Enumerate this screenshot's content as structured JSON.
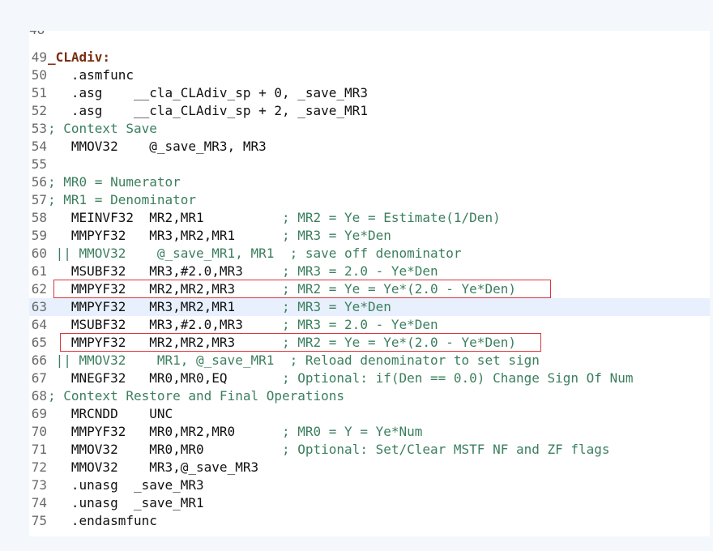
{
  "colors": {
    "comment": "#3b7f5e",
    "label": "#7a2e10",
    "highlight_border": "#d9363e",
    "current_line": "#e8f0fe"
  },
  "lines": [
    {
      "num": "49",
      "text": "",
      "label": "_CLAdiv:",
      "comment": ""
    },
    {
      "num": "50",
      "text": "   .asmfunc",
      "label": "",
      "comment": ""
    },
    {
      "num": "51",
      "text": "   .asg    __cla_CLAdiv_sp + 0, _save_MR3",
      "label": "",
      "comment": ""
    },
    {
      "num": "52",
      "text": "   .asg    __cla_CLAdiv_sp + 2, _save_MR1",
      "label": "",
      "comment": ""
    },
    {
      "num": "53",
      "text": "",
      "label": "",
      "comment": "; Context Save"
    },
    {
      "num": "54",
      "text": "   MMOV32    @_save_MR3, MR3",
      "label": "",
      "comment": ""
    },
    {
      "num": "55",
      "text": "",
      "label": "",
      "comment": ""
    },
    {
      "num": "56",
      "text": "",
      "label": "",
      "comment": "; MR0 = Numerator"
    },
    {
      "num": "57",
      "text": "",
      "label": "",
      "comment": "; MR1 = Denominator"
    },
    {
      "num": "58",
      "text": "   MEINVF32  MR2,MR1          ",
      "label": "",
      "comment": "; MR2 = Ye = Estimate(1/Den)"
    },
    {
      "num": "59",
      "text": "   MMPYF32   MR3,MR2,MR1      ",
      "label": "",
      "comment": "; MR3 = Ye*Den"
    },
    {
      "num": "60",
      "text": "",
      "label": "",
      "comment": " || MMOV32    @_save_MR1, MR1  ; save off denominator"
    },
    {
      "num": "61",
      "text": "   MSUBF32   MR3,#2.0,MR3     ",
      "label": "",
      "comment": "; MR3 = 2.0 - Ye*Den"
    },
    {
      "num": "62",
      "text": "   MMPYF32   MR2,MR2,MR3      ",
      "label": "",
      "comment": "; MR2 = Ye = Ye*(2.0 - Ye*Den)"
    },
    {
      "num": "63",
      "text": "   MMPYF32   MR3,MR2,MR1      ",
      "label": "",
      "comment": "; MR3 = Ye*Den"
    },
    {
      "num": "64",
      "text": "   MSUBF32   MR3,#2.0,MR3     ",
      "label": "",
      "comment": "; MR3 = 2.0 - Ye*Den"
    },
    {
      "num": "65",
      "text": "   MMPYF32   MR2,MR2,MR3      ",
      "label": "",
      "comment": "; MR2 = Ye = Ye*(2.0 - Ye*Den)"
    },
    {
      "num": "66",
      "text": "",
      "label": "",
      "comment": " || MMOV32    MR1, @_save_MR1  ; Reload denominator to set sign"
    },
    {
      "num": "67",
      "text": "   MNEGF32   MR0,MR0,EQ       ",
      "label": "",
      "comment": "; Optional: if(Den == 0.0) Change Sign Of Num"
    },
    {
      "num": "68",
      "text": "",
      "label": "",
      "comment": "; Context Restore and Final Operations"
    },
    {
      "num": "69",
      "text": "   MRCNDD    UNC",
      "label": "",
      "comment": ""
    },
    {
      "num": "70",
      "text": "   MMPYF32   MR0,MR2,MR0      ",
      "label": "",
      "comment": "; MR0 = Y = Ye*Num"
    },
    {
      "num": "71",
      "text": "   MMOV32    MR0,MR0          ",
      "label": "",
      "comment": "; Optional: Set/Clear MSTF NF and ZF flags"
    },
    {
      "num": "72",
      "text": "   MMOV32    MR3,@_save_MR3",
      "label": "",
      "comment": ""
    },
    {
      "num": "73",
      "text": "   .unasg  _save_MR3",
      "label": "",
      "comment": ""
    },
    {
      "num": "74",
      "text": "   .unasg  _save_MR1",
      "label": "",
      "comment": ""
    },
    {
      "num": "75",
      "text": "   .endasmfunc",
      "label": "",
      "comment": ""
    }
  ]
}
